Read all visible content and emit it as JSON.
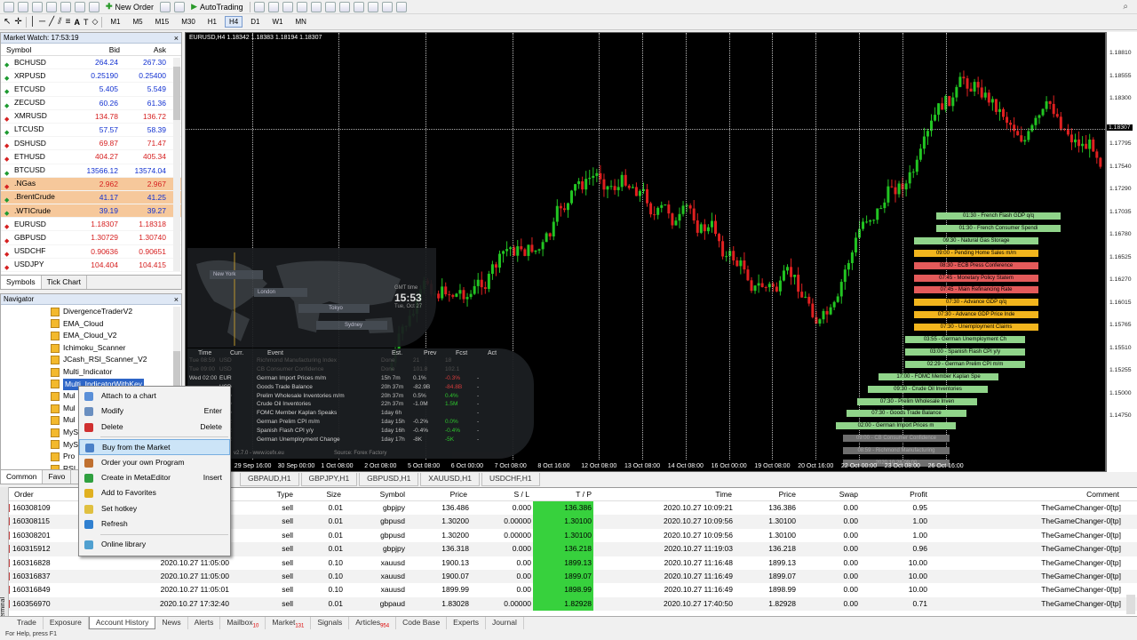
{
  "toolbar": {
    "new_order": "New Order",
    "auto_trading": "AutoTrading",
    "timeframes": [
      "M1",
      "M5",
      "M15",
      "M30",
      "H1",
      "H4",
      "D1",
      "W1",
      "MN"
    ],
    "active_timeframe": "H4"
  },
  "market_watch": {
    "title": "Market Watch: 17:53:19",
    "headers": {
      "symbol": "Symbol",
      "bid": "Bid",
      "ask": "Ask"
    },
    "rows": [
      {
        "s": "BCHUSD",
        "b": "264.24",
        "a": "267.30",
        "dir": "up"
      },
      {
        "s": "XRPUSD",
        "b": "0.25190",
        "a": "0.25400",
        "dir": "up"
      },
      {
        "s": "ETCUSD",
        "b": "5.405",
        "a": "5.549",
        "dir": "up"
      },
      {
        "s": "ZECUSD",
        "b": "60.26",
        "a": "61.36",
        "dir": "up"
      },
      {
        "s": "XMRUSD",
        "b": "134.78",
        "a": "136.72",
        "dir": "dn"
      },
      {
        "s": "LTCUSD",
        "b": "57.57",
        "a": "58.39",
        "dir": "up"
      },
      {
        "s": "DSHUSD",
        "b": "69.87",
        "a": "71.47",
        "dir": "dn"
      },
      {
        "s": "ETHUSD",
        "b": "404.27",
        "a": "405.34",
        "dir": "dn"
      },
      {
        "s": "BTCUSD",
        "b": "13566.12",
        "a": "13574.04",
        "dir": "up"
      },
      {
        "s": ".NGas",
        "b": "2.962",
        "a": "2.967",
        "dir": "dn",
        "hl": true
      },
      {
        "s": ".BrentCrude",
        "b": "41.17",
        "a": "41.25",
        "dir": "up",
        "hl": true
      },
      {
        "s": ".WTICrude",
        "b": "39.19",
        "a": "39.27",
        "dir": "up",
        "hl": true
      },
      {
        "s": "EURUSD",
        "b": "1.18307",
        "a": "1.18318",
        "dir": "dn"
      },
      {
        "s": "GBPUSD",
        "b": "1.30729",
        "a": "1.30740",
        "dir": "dn"
      },
      {
        "s": "USDCHF",
        "b": "0.90636",
        "a": "0.90651",
        "dir": "dn"
      },
      {
        "s": "USDJPY",
        "b": "104.404",
        "a": "104.415",
        "dir": "dn"
      }
    ],
    "tabs": [
      "Symbols",
      "Tick Chart"
    ]
  },
  "navigator": {
    "title": "Navigator",
    "items": [
      "DivergenceTraderV2",
      "EMA_Cloud",
      "EMA_Cloud_V2",
      "Ichimoku_Scanner",
      "JCash_RSI_Scanner_V2",
      "Multi_Indicator",
      "Multi_IndicatorWithKey",
      "Mul",
      "Mul",
      "Mul",
      "MyS",
      "MyS",
      "Pro",
      "RSI"
    ],
    "selected": 6,
    "tabs": [
      "Common",
      "Favo"
    ]
  },
  "context_menu": {
    "items": [
      {
        "label": "Attach to a chart",
        "key": "",
        "icon": "chart-icon",
        "color": "#5a8fd8"
      },
      {
        "label": "Modify",
        "key": "Enter",
        "icon": "modify-icon",
        "color": "#6a8fc0"
      },
      {
        "label": "Delete",
        "key": "Delete",
        "icon": "delete-icon",
        "color": "#d03030"
      },
      {
        "sep": true
      },
      {
        "label": "Buy from the Market",
        "key": "",
        "icon": "market-icon",
        "color": "#4a80c8",
        "hover": true
      },
      {
        "label": "Order your own Program",
        "key": "",
        "icon": "order-icon",
        "color": "#c07030"
      },
      {
        "label": "Create in MetaEditor",
        "key": "Insert",
        "icon": "create-icon",
        "color": "#30a040"
      },
      {
        "label": "Add to Favorites",
        "key": "",
        "icon": "favorites-icon",
        "color": "#e0b020"
      },
      {
        "label": "Set hotkey",
        "key": "",
        "icon": "hotkey-icon",
        "color": "#e0c040"
      },
      {
        "label": "Refresh",
        "key": "",
        "icon": "refresh-icon",
        "color": "#3080d0"
      },
      {
        "sep": true
      },
      {
        "label": "Online library",
        "key": "",
        "icon": "library-icon",
        "color": "#50a0d0"
      }
    ]
  },
  "chart": {
    "title": "EURUSD,H4  1.18342 1.18383 1.18194 1.18307",
    "price_labels": [
      "1.18810",
      "1.18555",
      "1.18300",
      "1.18307",
      "1.17795",
      "1.17540",
      "1.17290",
      "1.17035",
      "1.16780",
      "1.16525",
      "1.16270",
      "1.16015",
      "1.15765",
      "1.15510",
      "1.15255",
      "1.15000",
      "1.14750"
    ],
    "time_labels": [
      "28 Sep 2020",
      "29 Sep 16:00",
      "30 Sep 00:00",
      "1 Oct 08:00",
      "2 Oct 08:00",
      "5 Oct 08:00",
      "6 Oct 00:00",
      "7 Oct 08:00",
      "8 Oct 16:00",
      "12 Oct 08:00",
      "13 Oct 08:00",
      "14 Oct 08:00",
      "16 Oct 00:00",
      "19 Oct 08:00",
      "20 Oct 16:00",
      "22 Oct 00:00",
      "23 Oct 08:00",
      "26 Oct 16:00"
    ],
    "news_tags": [
      {
        "t": "01:30 - French Flash GDP q/q",
        "c": "ng"
      },
      {
        "t": "01:30 - French Consumer Spendi",
        "c": "ng"
      },
      {
        "t": "09:30 - Natural Gas Storage",
        "c": "ng"
      },
      {
        "t": "09:00 - Pending Home Sales m/m",
        "c": "no"
      },
      {
        "t": "08:30 - ECB Press Conference",
        "c": "nr"
      },
      {
        "t": "07:45 - Monetary Policy Statem",
        "c": "nr"
      },
      {
        "t": "07:45 - Main Refinancing Rate",
        "c": "nr"
      },
      {
        "t": "07:30 - Advance GDP q/q",
        "c": "no"
      },
      {
        "t": "07:30 - Advance GDP Price Inde",
        "c": "no"
      },
      {
        "t": "07:30 - Unemployment Claims",
        "c": "no"
      },
      {
        "t": "03:55 - German Unemployment Ch",
        "c": "ng"
      },
      {
        "t": "03:00 - Spanish Flash CPI y/y",
        "c": "ng"
      },
      {
        "t": "02:29 - German Prelim CPI m/m",
        "c": "ng"
      },
      {
        "t": "17:00 - FOMC Member Kaplan Spe",
        "c": "ng"
      },
      {
        "t": "09:30 - Crude Oil Inventories",
        "c": "ng"
      },
      {
        "t": "07:30 - Prelim Wholesale Inven",
        "c": "ng"
      },
      {
        "t": "07:30 - Goods Trade Balance",
        "c": "ng"
      },
      {
        "t": "02:00 - German Import Prices m",
        "c": "ng"
      },
      {
        "t": "09:00 - CB Consumer Confidence",
        "c": "ngr"
      },
      {
        "t": "08:59 - Richmond Manufacturing",
        "c": "ngr"
      },
      {
        "t": "2020.10.28 09:00",
        "c": "ngr"
      }
    ]
  },
  "world_clock": {
    "cities": [
      "New York",
      "London",
      "Tokyo",
      "Sydney"
    ],
    "gmt_label": "GMT time",
    "time": "15:53",
    "date": "Tue, Oct 27"
  },
  "calendar": {
    "headers": [
      "Time",
      "Curr.",
      "Event",
      "Est.",
      "Prev",
      "Fcst",
      "Act"
    ],
    "rows": [
      [
        "Tue 08:59",
        "USD",
        "Richmond Manufacturing Index",
        "Done",
        "21",
        "18",
        ""
      ],
      [
        "Tue 09:00",
        "USD",
        "CB Consumer Confidence",
        "Done",
        "101.8",
        "102.1",
        ""
      ],
      [
        "Wed 02:00",
        "EUR",
        "German Import Prices m/m",
        "15h 7m",
        "0.1%",
        "-0.3%",
        "-"
      ],
      [
        "",
        "USD",
        "Goods Trade Balance",
        "20h 37m",
        "-82.9B",
        "-84.8B",
        "-"
      ],
      [
        "",
        "USD",
        "Prelim Wholesale Inventories m/m",
        "20h 37m",
        "0.5%",
        "0.4%",
        "-"
      ],
      [
        "",
        "USD",
        "Crude Oil Inventories",
        "22h 37m",
        "-1.0M",
        "1.5M",
        "-"
      ],
      [
        "",
        "USD",
        "FOMC Member Kaplan Speaks",
        "1day 6h",
        "",
        "",
        "-"
      ],
      [
        "",
        "EUR",
        "German Prelim CPI m/m",
        "1day 15h",
        "-0.2%",
        "0.0%",
        "-"
      ],
      [
        "",
        "EUR",
        "Spanish Flash CPI y/y",
        "1day 16h",
        "-0.4%",
        "-0.4%",
        "-"
      ],
      [
        "",
        "EUR",
        "German Unemployment Change",
        "1day 17h",
        "-8K",
        "-5K",
        "-"
      ]
    ],
    "footer_left": "v2.7.0 - www.icefx.eu",
    "footer_right": "Source: Forex Factory"
  },
  "chart_tabs": [
    "GBPAUD,H1",
    "GBPJPY,H1",
    "GBPUSD,H1",
    "XAUUSD,H1",
    "USDCHF,H1"
  ],
  "terminal": {
    "headers": [
      "Order",
      "Type",
      "Size",
      "Symbol",
      "Price",
      "S / L",
      "T / P",
      "Time",
      "Price",
      "Swap",
      "Profit",
      "Comment"
    ],
    "rows": [
      [
        "160308109",
        "",
        "sell",
        "0.01",
        "gbpjpy",
        "136.486",
        "0.000",
        "136.386",
        "2020.10.27 10:09:21",
        "136.386",
        "0.00",
        "0.95",
        "TheGameChanger-0[tp]"
      ],
      [
        "160308115",
        "",
        "sell",
        "0.01",
        "gbpusd",
        "1.30200",
        "0.00000",
        "1.30100",
        "2020.10.27 10:09:56",
        "1.30100",
        "0.00",
        "1.00",
        "TheGameChanger-0[tp]"
      ],
      [
        "160308201",
        "",
        "sell",
        "0.01",
        "gbpusd",
        "1.30200",
        "0.00000",
        "1.30100",
        "2020.10.27 10:09:56",
        "1.30100",
        "0.00",
        "1.00",
        "TheGameChanger-0[tp]"
      ],
      [
        "160315912",
        "",
        "sell",
        "0.01",
        "gbpjpy",
        "136.318",
        "0.000",
        "136.218",
        "2020.10.27 11:19:03",
        "136.218",
        "0.00",
        "0.96",
        "TheGameChanger-0[tp]"
      ],
      [
        "160316828",
        "2020.10.27 11:05:00",
        "sell",
        "0.10",
        "xauusd",
        "1900.13",
        "0.00",
        "1899.13",
        "2020.10.27 11:16:48",
        "1899.13",
        "0.00",
        "10.00",
        "TheGameChanger-0[tp]"
      ],
      [
        "160316837",
        "2020.10.27 11:05:00",
        "sell",
        "0.10",
        "xauusd",
        "1900.07",
        "0.00",
        "1899.07",
        "2020.10.27 11:16:49",
        "1899.07",
        "0.00",
        "10.00",
        "TheGameChanger-0[tp]"
      ],
      [
        "160316849",
        "2020.10.27 11:05:01",
        "sell",
        "0.10",
        "xauusd",
        "1899.99",
        "0.00",
        "1898.99",
        "2020.10.27 11:16:49",
        "1898.99",
        "0.00",
        "10.00",
        "TheGameChanger-0[tp]"
      ],
      [
        "160356970",
        "2020.10.27 17:32:40",
        "sell",
        "0.01",
        "gbpaud",
        "1.83028",
        "0.00000",
        "1.82928",
        "2020.10.27 17:40:50",
        "1.82928",
        "0.00",
        "0.71",
        "TheGameChanger-0[tp]"
      ]
    ],
    "tabs": [
      {
        "l": "Trade"
      },
      {
        "l": "Exposure"
      },
      {
        "l": "Account History",
        "on": true
      },
      {
        "l": "News"
      },
      {
        "l": "Alerts"
      },
      {
        "l": "Mailbox",
        "b": "10"
      },
      {
        "l": "Market",
        "b": "131"
      },
      {
        "l": "Signals"
      },
      {
        "l": "Articles",
        "b": "954"
      },
      {
        "l": "Code Base"
      },
      {
        "l": "Experts"
      },
      {
        "l": "Journal"
      }
    ],
    "side_label": "Terminal"
  },
  "status": "For Help, press F1"
}
